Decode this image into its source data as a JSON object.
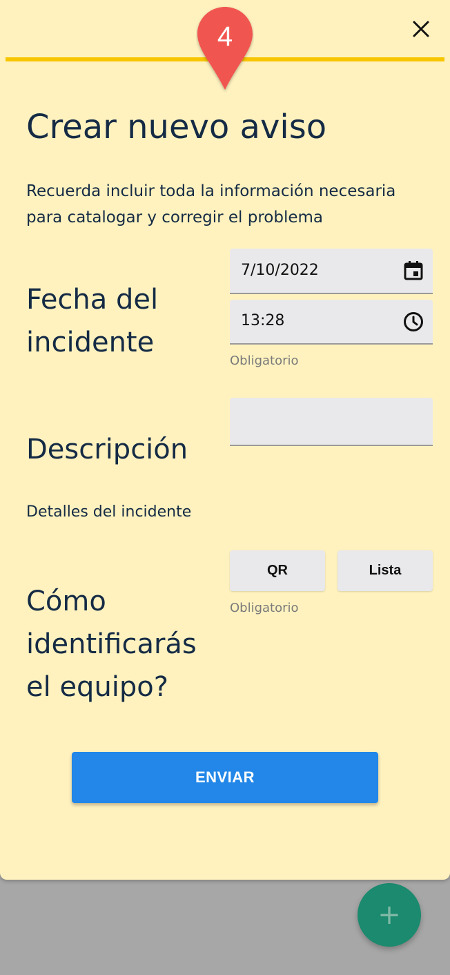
{
  "marker": {
    "number": "4",
    "color": "#f0564f"
  },
  "dialog": {
    "title": "Crear nuevo aviso",
    "subtitle": "Recuerda incluir toda la información necesaria para catalogar y corregir el problema",
    "accent_line_color": "#f7c600",
    "background": "#fff2bf",
    "close_icon": "close-icon"
  },
  "date_section": {
    "label": "Fecha del incidente",
    "date_value": "7/10/2022",
    "date_icon": "calendar-icon",
    "time_value": "13:28",
    "time_icon": "clock-icon",
    "helper": "Obligatorio"
  },
  "description_section": {
    "label": "Descripción",
    "value": "",
    "details_label": "Detalles del incidente"
  },
  "identify_section": {
    "label": "Cómo identificarás el equipo?",
    "options": [
      "QR",
      "Lista"
    ],
    "helper": "Obligatorio"
  },
  "submit": {
    "label": "ENVIAR",
    "color": "#2287e8"
  },
  "fab": {
    "icon": "plus-icon",
    "color": "#1b8a6e"
  }
}
